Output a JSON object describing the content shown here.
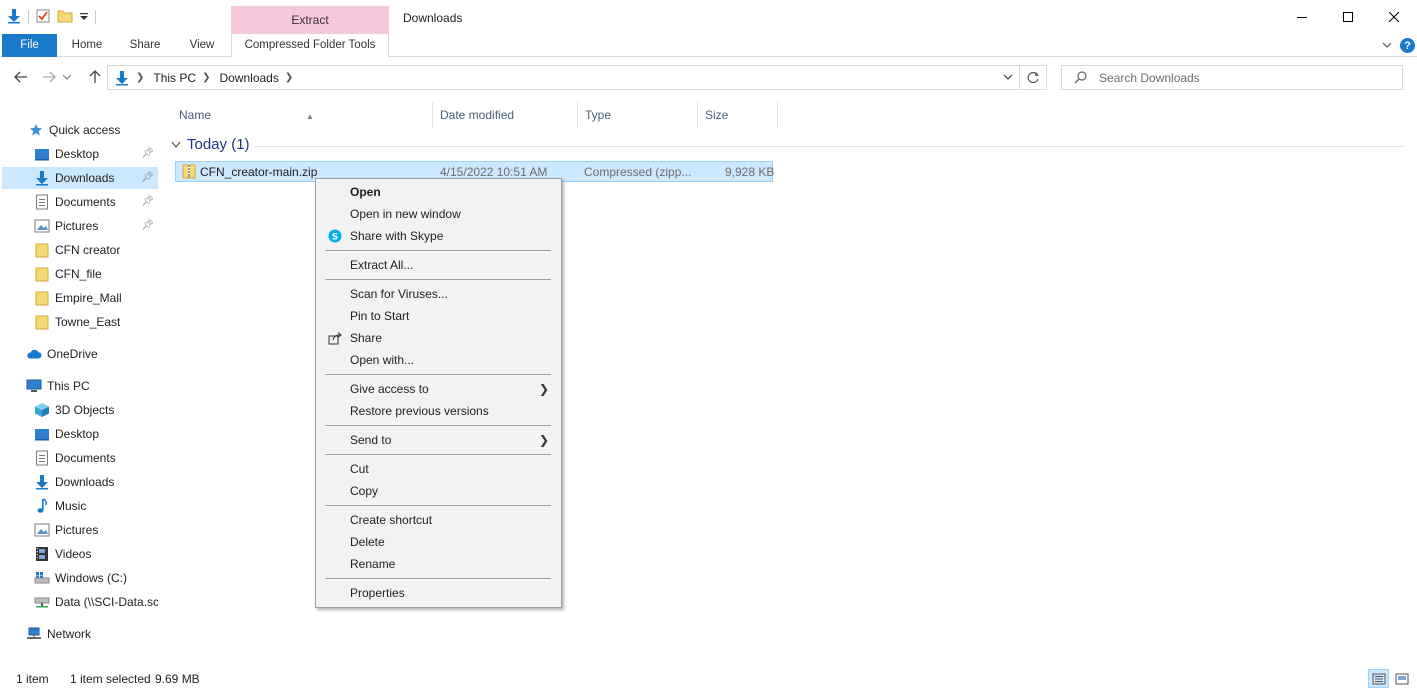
{
  "window": {
    "title": "Downloads",
    "context_group": "Extract",
    "context_tab": "Compressed Folder Tools"
  },
  "ribbon": {
    "file": "File",
    "home": "Home",
    "share": "Share",
    "view": "View",
    "help": "?"
  },
  "address": {
    "crumbs": [
      "This PC",
      "Downloads"
    ],
    "search_placeholder": "Search Downloads"
  },
  "nav": {
    "quick_access": "Quick access",
    "qa_items": [
      "Desktop",
      "Downloads",
      "Documents",
      "Pictures",
      "CFN creator",
      "CFN_file",
      "Empire_Mall",
      "Towne_East"
    ],
    "onedrive": "OneDrive",
    "this_pc": "This PC",
    "pc_items": [
      "3D Objects",
      "Desktop",
      "Documents",
      "Downloads",
      "Music",
      "Pictures",
      "Videos",
      "Windows (C:)",
      "Data (\\\\SCI-Data.sci"
    ],
    "network": "Network"
  },
  "columns": {
    "name": "Name",
    "date": "Date modified",
    "type": "Type",
    "size": "Size"
  },
  "group": {
    "label": "Today (1)"
  },
  "file": {
    "name": "CFN_creator-main.zip",
    "date": "4/15/2022 10:51 AM",
    "type": "Compressed (zipp...",
    "size": "9,928 KB"
  },
  "context_menu": {
    "open": "Open",
    "open_new_window": "Open in new window",
    "share_skype": "Share with Skype",
    "extract_all": "Extract All...",
    "scan": "Scan for Viruses...",
    "pin_start": "Pin to Start",
    "share": "Share",
    "open_with": "Open with...",
    "give_access": "Give access to",
    "restore": "Restore previous versions",
    "send_to": "Send to",
    "cut": "Cut",
    "copy": "Copy",
    "create_shortcut": "Create shortcut",
    "delete": "Delete",
    "rename": "Rename",
    "properties": "Properties"
  },
  "status": {
    "count": "1 item",
    "selected": "1 item selected",
    "size": "9.69 MB"
  },
  "colors": {
    "accent": "#1979ca",
    "selection": "#cce8ff",
    "context_tab": "#f7c8dc",
    "folder": "#f8d775"
  }
}
